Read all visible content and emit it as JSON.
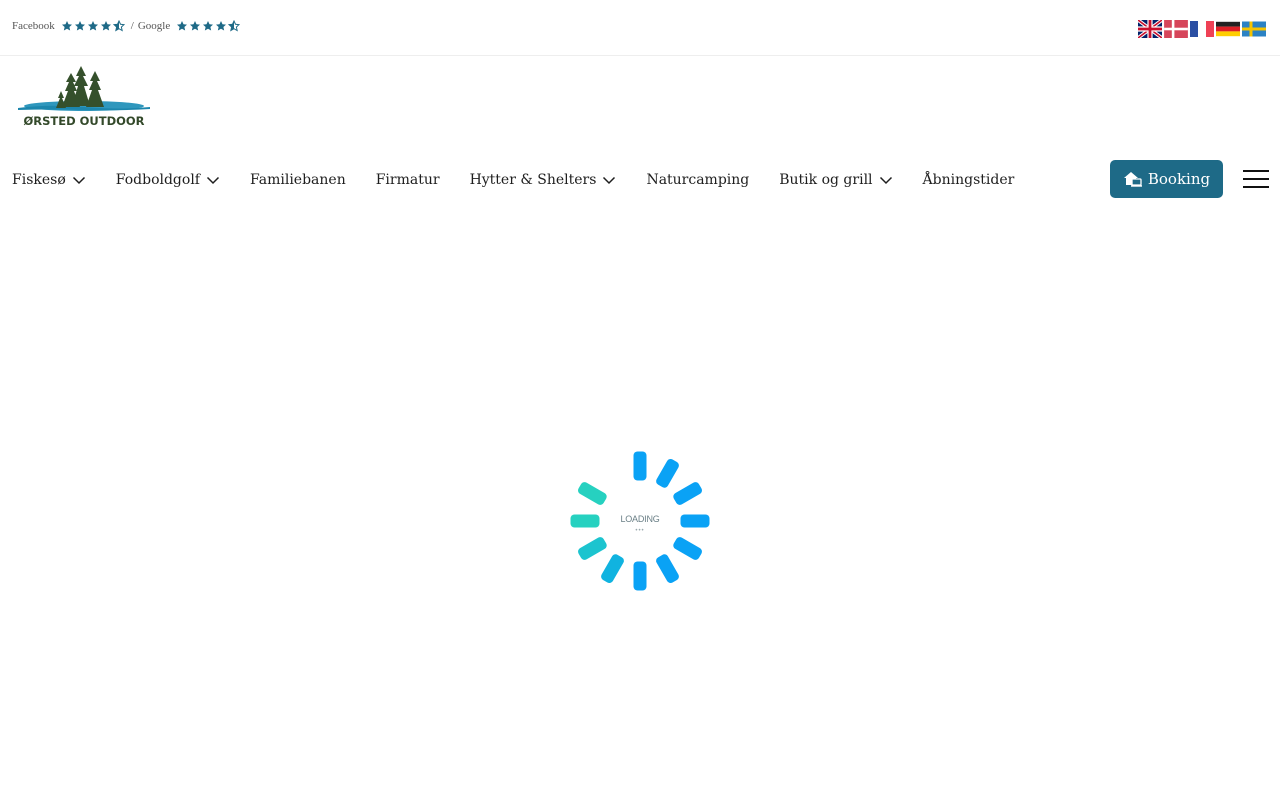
{
  "topbar": {
    "facebook_label": "Facebook",
    "separator": "/",
    "google_label": "Google",
    "facebook_rating_stars": 4.5,
    "google_rating_stars": 4.5,
    "star_color": "#1e6a87",
    "languages": [
      "english-flag",
      "danish-flag",
      "french-flag",
      "german-flag",
      "swedish-flag"
    ]
  },
  "brand": {
    "logo_text": "ØRSTED OUTDOOR"
  },
  "nav": {
    "items": [
      {
        "label": "Fiskesø",
        "has_dropdown": true
      },
      {
        "label": "Fodboldgolf",
        "has_dropdown": true
      },
      {
        "label": "Familiebanen",
        "has_dropdown": false
      },
      {
        "label": "Firmatur",
        "has_dropdown": false
      },
      {
        "label": "Hytter & Shelters",
        "has_dropdown": true
      },
      {
        "label": "Naturcamping",
        "has_dropdown": false
      },
      {
        "label": "Butik og grill",
        "has_dropdown": true
      },
      {
        "label": "Åbningstider",
        "has_dropdown": false
      }
    ],
    "booking_label": "Booking",
    "booking_color": "#1e6a87"
  },
  "loader": {
    "text": "LOADING",
    "dots": "•••",
    "colors": {
      "teal": "#26d1c0",
      "blue": "#0aa2f5"
    }
  }
}
